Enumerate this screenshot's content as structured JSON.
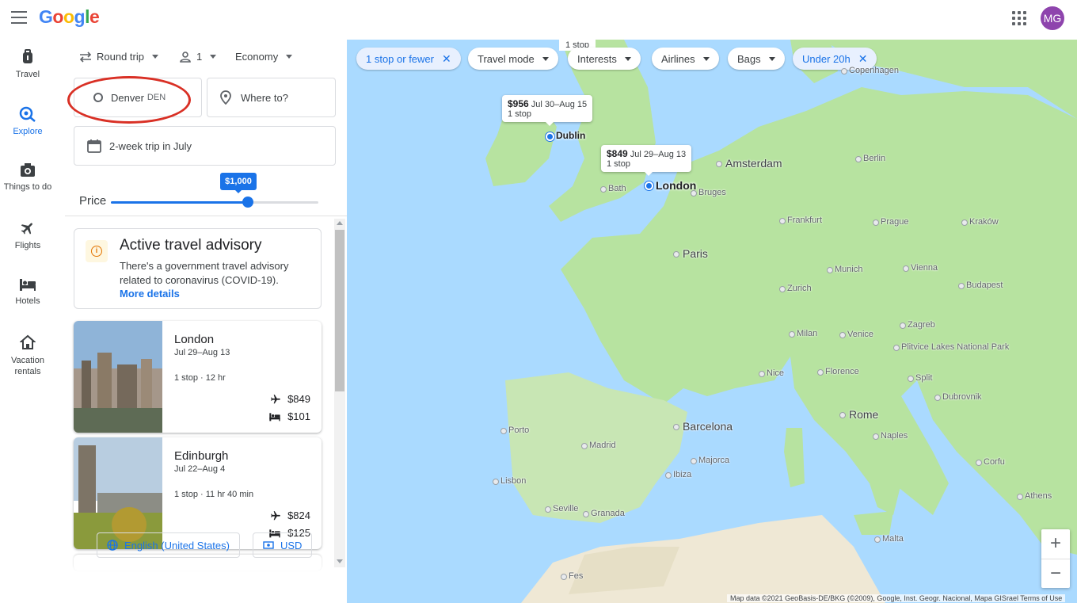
{
  "header": {
    "avatar_initials": "MG"
  },
  "nav": [
    {
      "label": "Travel",
      "icon": "suitcase-icon"
    },
    {
      "label": "Explore",
      "icon": "explore-icon"
    },
    {
      "label": "Things to do",
      "icon": "camera-icon"
    },
    {
      "label": "Flights",
      "icon": "plane-icon"
    },
    {
      "label": "Hotels",
      "icon": "bed-icon"
    },
    {
      "label": "Vacation rentals",
      "icon": "house-icon"
    }
  ],
  "search": {
    "trip_type": "Round trip",
    "passengers": "1",
    "cabin": "Economy",
    "origin": "Denver",
    "origin_code": "DEN",
    "destination_placeholder": "Where to?",
    "dates": "2-week trip in July"
  },
  "price": {
    "label": "Price",
    "value": "$1,000",
    "fraction": 0.64
  },
  "advisory": {
    "title": "Active travel advisory",
    "text": "There's a government travel advisory related to coronavirus (COVID-19).",
    "link": "More details"
  },
  "results": [
    {
      "city": "London",
      "dates": "Jul 29–Aug 13",
      "stops": "1 stop · 12 hr",
      "flight": "$849",
      "hotel": "$101"
    },
    {
      "city": "Edinburgh",
      "dates": "Jul 22–Aug 4",
      "stops": "1 stop · 11 hr 40 min",
      "flight": "$824",
      "hotel": "$125"
    }
  ],
  "footer": {
    "language": "English (United States)",
    "currency": "USD"
  },
  "map": {
    "filters": [
      {
        "label": "1 stop or fewer",
        "active": true
      },
      {
        "label": "Travel mode",
        "active": false
      },
      {
        "label": "Interests",
        "active": false
      },
      {
        "label": "Airlines",
        "active": false
      },
      {
        "label": "Bags",
        "active": false
      },
      {
        "label": "Under 20h",
        "active": true
      }
    ],
    "top_partial_label": "1 stop",
    "bubbles": [
      {
        "price": "$956",
        "dates": "Jul 30–Aug 15",
        "stops": "1 stop"
      },
      {
        "price": "$849",
        "dates": "Jul 29–Aug 13",
        "stops": "1 stop"
      }
    ],
    "destinations": [
      "Dublin",
      "London"
    ],
    "cities_big": [
      "Amsterdam",
      "Paris",
      "Barcelona",
      "Rome"
    ],
    "cities": [
      "Copenhagen",
      "Berlin",
      "Bath",
      "Bruges",
      "Frankfurt",
      "Prague",
      "Kraków",
      "Munich",
      "Vienna",
      "Budapest",
      "Zurich",
      "Milan",
      "Venice",
      "Zagreb",
      "Plitvice Lakes National Park",
      "Nice",
      "Florence",
      "Split",
      "Dubrovnik",
      "Porto",
      "Madrid",
      "Naples",
      "Majorca",
      "Ibiza",
      "Lisbon",
      "Corfu",
      "Seville",
      "Granada",
      "Athens",
      "Malta",
      "Fes"
    ],
    "attribution": "Map data ©2021 GeoBasis-DE/BKG (©2009), Google, Inst. Geogr. Nacional, Mapa GISrael    Terms of Use",
    "colors": {
      "water": "#aadaff",
      "land": "#b7e3a0",
      "accent": "#1a73e8"
    }
  }
}
